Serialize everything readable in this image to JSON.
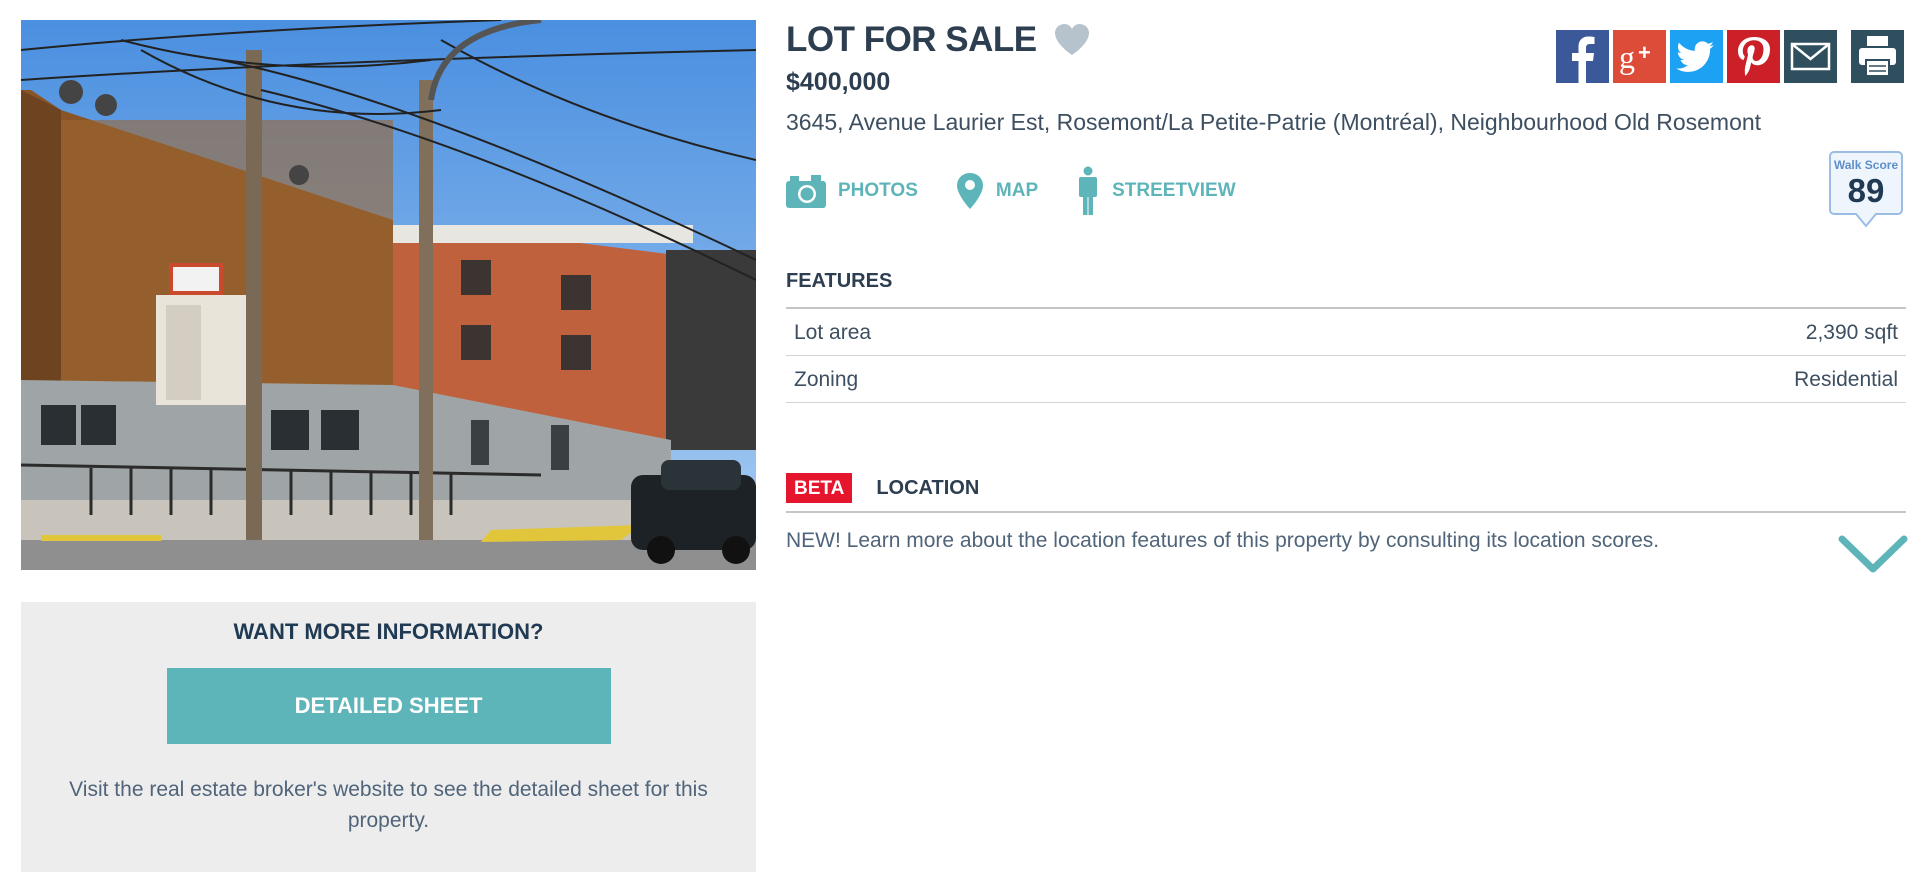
{
  "listing": {
    "title": "LOT FOR SALE",
    "price": "$400,000",
    "address": "3645, Avenue Laurier Est, Rosemont/La Petite-Patrie (Montréal), Neighbourhood Old Rosemont"
  },
  "share": {
    "buttons": [
      {
        "name": "facebook",
        "icon": "facebook-icon",
        "color": "#3b5998"
      },
      {
        "name": "google-plus",
        "icon": "google-plus-icon",
        "color": "#dd4b39"
      },
      {
        "name": "twitter",
        "icon": "twitter-icon",
        "color": "#1da1f2"
      },
      {
        "name": "pinterest",
        "icon": "pinterest-icon",
        "color": "#cb2027"
      },
      {
        "name": "email",
        "icon": "envelope-icon",
        "color": "#2f4f5f"
      },
      {
        "name": "print",
        "icon": "printer-icon",
        "color": "#2f4f5f"
      }
    ]
  },
  "actions": {
    "photos": "PHOTOS",
    "map": "MAP",
    "streetview": "STREETVIEW"
  },
  "walkscore": {
    "label": "Walk Score",
    "value": "89"
  },
  "features": {
    "title": "FEATURES",
    "rows": [
      {
        "label": "Lot area",
        "value": "2,390 sqft"
      },
      {
        "label": "Zoning",
        "value": "Residential"
      }
    ]
  },
  "location": {
    "badge": "BETA",
    "title": "LOCATION",
    "text": "NEW! Learn more about the location features of this property by consulting its location scores."
  },
  "info_box": {
    "title": "WANT MORE INFORMATION?",
    "button": "DETAILED SHEET",
    "text": "Visit the real estate broker's website to see the detailed sheet for this property."
  },
  "colors": {
    "accent": "#5eb5b9",
    "heading": "#2c3e50",
    "beta": "#e5152e"
  }
}
